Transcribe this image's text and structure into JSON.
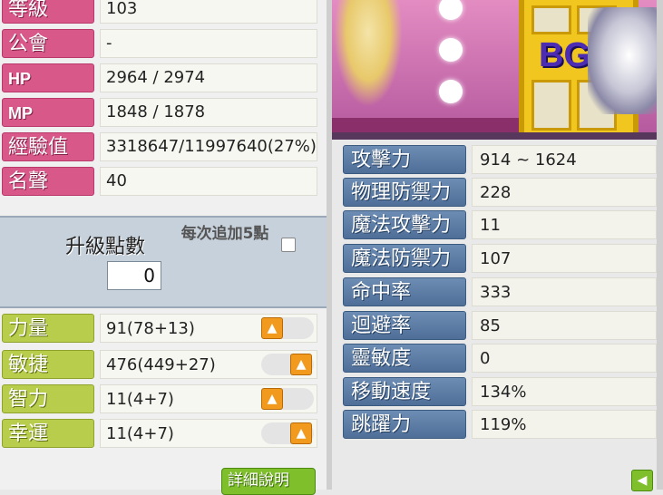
{
  "character": {
    "level_label": "等級",
    "level": "103",
    "guild_label": "公會",
    "guild": "-",
    "hp_label": "HP",
    "hp": "2964 / 2974",
    "mp_label": "MP",
    "mp": "1848 / 1878",
    "exp_label": "經驗值",
    "exp": "3318647/11997640(27%)",
    "fame_label": "名聲",
    "fame": "40"
  },
  "ap": {
    "title": "升級點數",
    "value": "0",
    "each_label": "每次追加5點"
  },
  "stats": [
    {
      "label": "力量",
      "value": "91(78+13)"
    },
    {
      "label": "敏捷",
      "value": "476(449+27)"
    },
    {
      "label": "智力",
      "value": "11(4+7)"
    },
    {
      "label": "幸運",
      "value": "11(4+7)"
    }
  ],
  "detail_button": "詳細說明",
  "scene": {
    "logo": "BG"
  },
  "combat": [
    {
      "label": "攻擊力",
      "value": "914 ~ 1624"
    },
    {
      "label": "物理防禦力",
      "value": "228"
    },
    {
      "label": "魔法攻擊力",
      "value": "11"
    },
    {
      "label": "魔法防禦力",
      "value": "107"
    },
    {
      "label": "命中率",
      "value": "333"
    },
    {
      "label": "迴避率",
      "value": "85"
    },
    {
      "label": "靈敏度",
      "value": "0"
    },
    {
      "label": "移動速度",
      "value": "134%"
    },
    {
      "label": "跳躍力",
      "value": "119%"
    }
  ],
  "icons": {
    "up_arrow": "arrow-up-icon",
    "back_arrow": "arrow-left-icon"
  }
}
